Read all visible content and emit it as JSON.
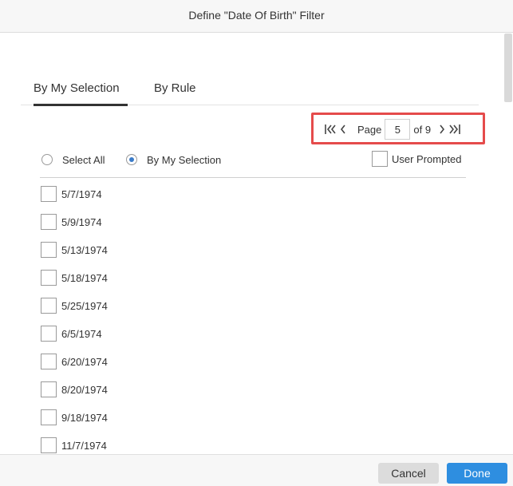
{
  "dialog": {
    "title": "Define \"Date Of Birth\" Filter"
  },
  "tabs": [
    {
      "label": "By My Selection",
      "active": true
    },
    {
      "label": "By Rule",
      "active": false
    }
  ],
  "pager": {
    "first_icon": "first-page-icon",
    "prev_icon": "previous-page-icon",
    "next_icon": "next-page-icon",
    "last_icon": "last-page-icon",
    "page_label": "Page",
    "current_page": "5",
    "of_label": "of 9"
  },
  "options": {
    "select_all_label": "Select All",
    "by_selection_label": "By My Selection",
    "selected_option": "By My Selection",
    "user_prompted_label": "User Prompted",
    "user_prompted_checked": false
  },
  "values": [
    {
      "label": "5/7/1974",
      "checked": false
    },
    {
      "label": "5/9/1974",
      "checked": false
    },
    {
      "label": "5/13/1974",
      "checked": false
    },
    {
      "label": "5/18/1974",
      "checked": false
    },
    {
      "label": "5/25/1974",
      "checked": false
    },
    {
      "label": "6/5/1974",
      "checked": false
    },
    {
      "label": "6/20/1974",
      "checked": false
    },
    {
      "label": "8/20/1974",
      "checked": false
    },
    {
      "label": "9/18/1974",
      "checked": false
    },
    {
      "label": "11/7/1974",
      "checked": false
    }
  ],
  "footer": {
    "cancel_label": "Cancel",
    "done_label": "Done"
  },
  "colors": {
    "accent": "#2e8ee0",
    "highlight": "#e54b4b",
    "radio_selected": "#3a7bc8"
  }
}
